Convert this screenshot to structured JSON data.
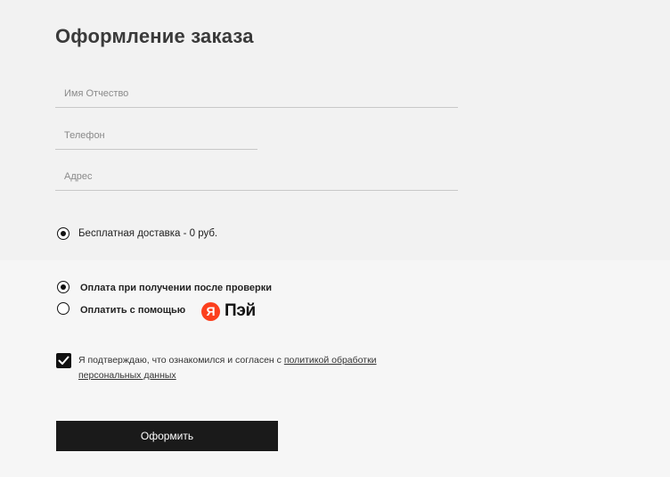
{
  "page": {
    "title": "Оформление заказа"
  },
  "form": {
    "name_placeholder": "Имя Отчество",
    "phone_placeholder": "Телефон",
    "address_placeholder": "Адрес"
  },
  "delivery": {
    "options": [
      {
        "label": "Бесплатная доставка - 0 руб.",
        "selected": true
      }
    ]
  },
  "payment": {
    "options": [
      {
        "label": "Оплата при получении после проверки",
        "selected": true
      },
      {
        "label": "Оплатить с помощью",
        "selected": false
      }
    ],
    "logo": {
      "letter": "Я",
      "text": "Пэй",
      "color": "#fc3f1d"
    }
  },
  "consent": {
    "checked": true,
    "text": "Я подтверждаю, что ознакомился и согласен с ",
    "link_part1": "политикой обработки",
    "link_part2": "персональных данных"
  },
  "submit": {
    "label": "Оформить"
  }
}
